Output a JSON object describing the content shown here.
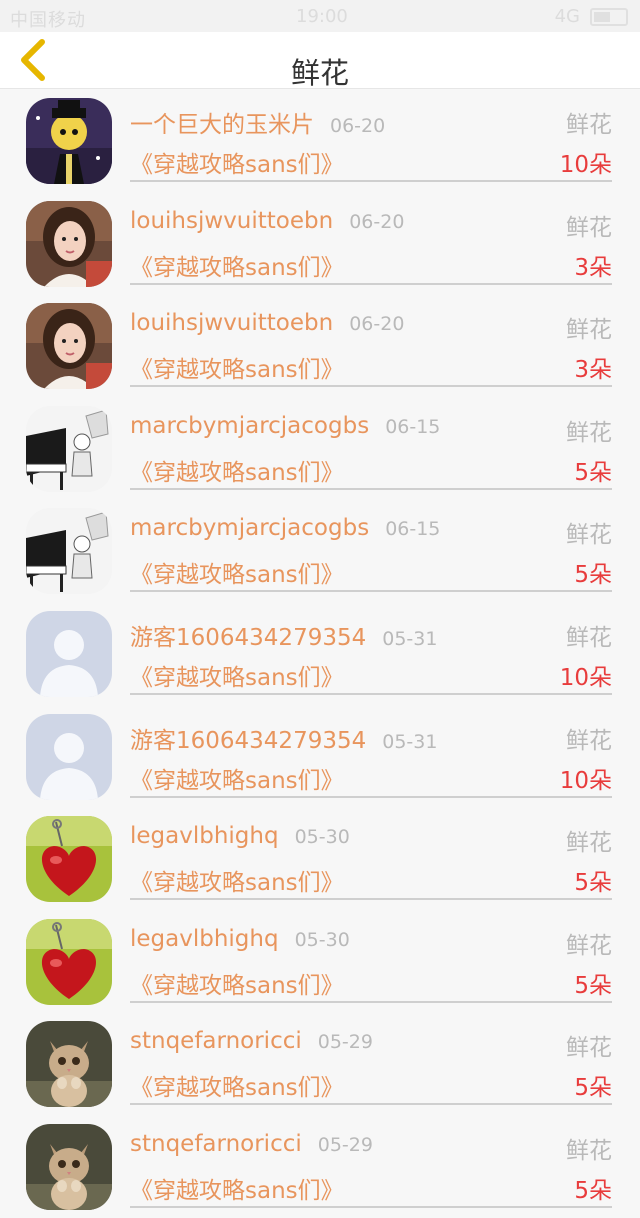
{
  "status_bar": {
    "carrier": "中国移动",
    "time": "19:00",
    "signal": "4G"
  },
  "nav": {
    "title": "鲜花",
    "back_icon": "chevron-left-icon",
    "back_color": "#e6b600"
  },
  "colors": {
    "name": "#e8955d",
    "count": "#e83c3c",
    "muted": "#b9b9b9"
  },
  "items": [
    {
      "name": "一个巨大的玉米片",
      "date": "06-20",
      "type": "鲜花",
      "work": "《穿越攻略sans们》",
      "count": "10朵",
      "avatar": "skeleton"
    },
    {
      "name": "louihsjwvuittoebn",
      "date": "06-20",
      "type": "鲜花",
      "work": "《穿越攻略sans们》",
      "count": "3朵",
      "avatar": "girl"
    },
    {
      "name": "louihsjwvuittoebn",
      "date": "06-20",
      "type": "鲜花",
      "work": "《穿越攻略sans们》",
      "count": "3朵",
      "avatar": "girl"
    },
    {
      "name": "marcbymjarcjacogbs",
      "date": "06-15",
      "type": "鲜花",
      "work": "《穿越攻略sans们》",
      "count": "5朵",
      "avatar": "piano"
    },
    {
      "name": "marcbymjarcjacogbs",
      "date": "06-15",
      "type": "鲜花",
      "work": "《穿越攻略sans们》",
      "count": "5朵",
      "avatar": "piano"
    },
    {
      "name": "游客1606434279354",
      "date": "05-31",
      "type": "鲜花",
      "work": "《穿越攻略sans们》",
      "count": "10朵",
      "avatar": "default"
    },
    {
      "name": "游客1606434279354",
      "date": "05-31",
      "type": "鲜花",
      "work": "《穿越攻略sans们》",
      "count": "10朵",
      "avatar": "default"
    },
    {
      "name": "legavlbhighq",
      "date": "05-30",
      "type": "鲜花",
      "work": "《穿越攻略sans们》",
      "count": "5朵",
      "avatar": "heart"
    },
    {
      "name": "legavlbhighq",
      "date": "05-30",
      "type": "鲜花",
      "work": "《穿越攻略sans们》",
      "count": "5朵",
      "avatar": "heart"
    },
    {
      "name": "stnqefarnoricci",
      "date": "05-29",
      "type": "鲜花",
      "work": "《穿越攻略sans们》",
      "count": "5朵",
      "avatar": "cat"
    },
    {
      "name": "stnqefarnoricci",
      "date": "05-29",
      "type": "鲜花",
      "work": "《穿越攻略sans们》",
      "count": "5朵",
      "avatar": "cat"
    }
  ]
}
